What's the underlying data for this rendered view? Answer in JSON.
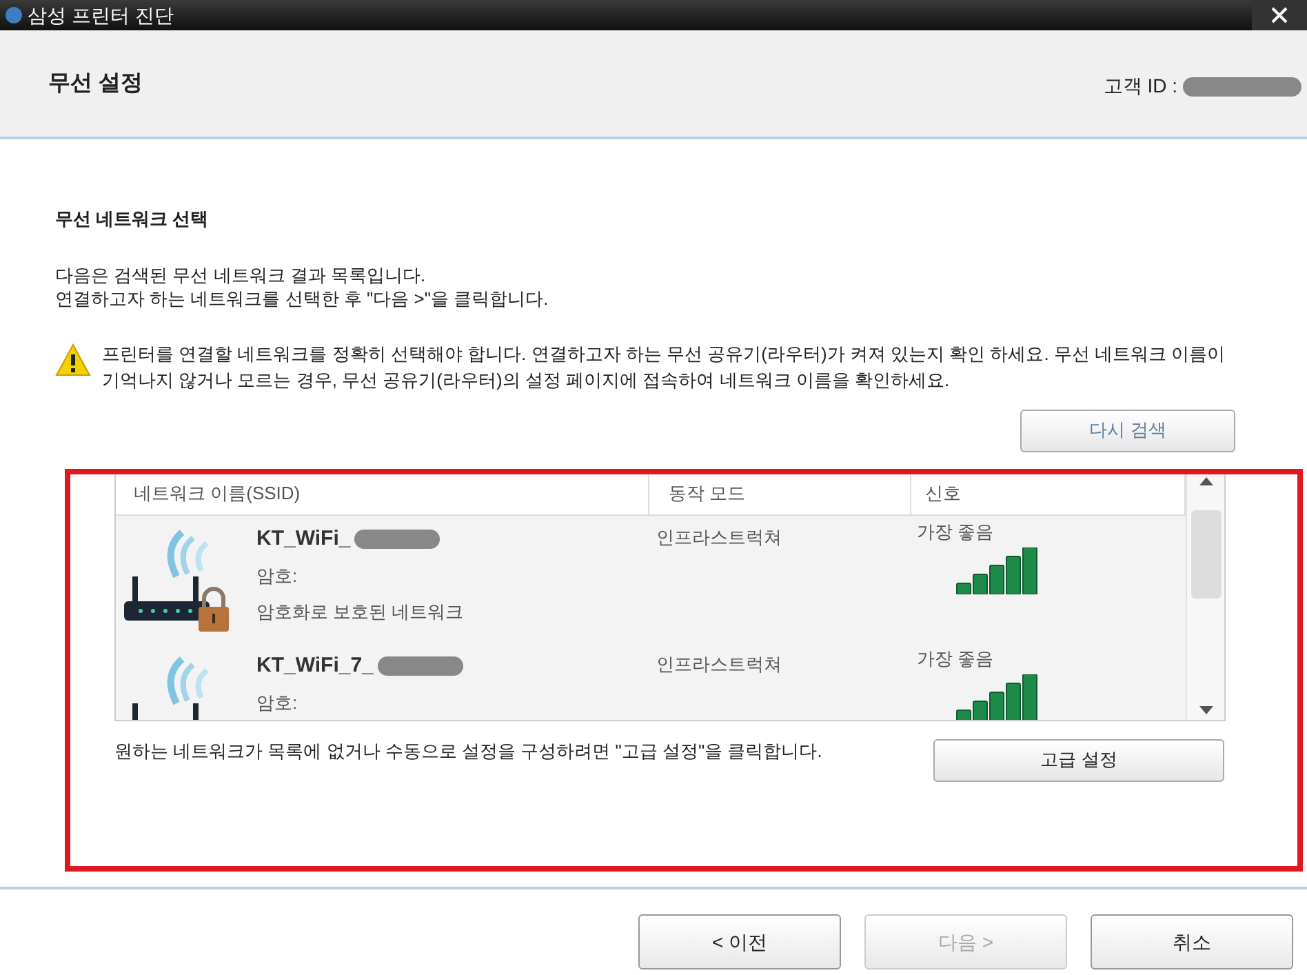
{
  "window": {
    "title": "삼성 프린터 진단"
  },
  "header": {
    "heading": "무선 설정",
    "customer_id_label": "고객 ID :"
  },
  "section_title": "무선 네트워크 선택",
  "description": [
    "다음은 검색된 무선 네트워크 결과 목록입니다.",
    "연결하고자 하는 네트워크를 선택한 후 \"다음 >\"을 클릭합니다."
  ],
  "warning": "프린터를 연결할 네트워크를 정확히 선택해야 합니다. 연결하고자 하는 무선 공유기(라우터)가 켜져 있는지 확인 하세요. 무선 네트워크 이름이 기억나지 않거나 모르는 경우, 무선 공유기(라우터)의 설정 페이지에 접속하여 네트워크 이름을 확인하세요.",
  "refresh_button": "다시 검색",
  "network_list": {
    "columns": [
      "네트워크 이름(SSID)",
      "동작 모드",
      "신호"
    ],
    "networks": [
      {
        "ssid": "KT_WiFi_",
        "password_label": "암호:",
        "security": "암호화로 보호된 네트워크",
        "locked": true,
        "mode": "인프라스트럭쳐",
        "signal": "가장 좋음"
      },
      {
        "ssid": "KT_WiFi_7_",
        "password_label": "암호:",
        "locked": false,
        "mode": "인프라스트럭쳐",
        "signal": "가장 좋음"
      }
    ]
  },
  "advanced_hint": "원하는 네트워크가 목록에 없거나 수동으로 설정을 구성하려면 \"고급 설정\"을 클릭합니다.",
  "advanced_button": "고급 설정",
  "buttons": [
    {
      "label": "< 이전",
      "disabled": false
    },
    {
      "label": "다음 >",
      "disabled": true
    },
    {
      "label": "취소",
      "disabled": false
    }
  ]
}
